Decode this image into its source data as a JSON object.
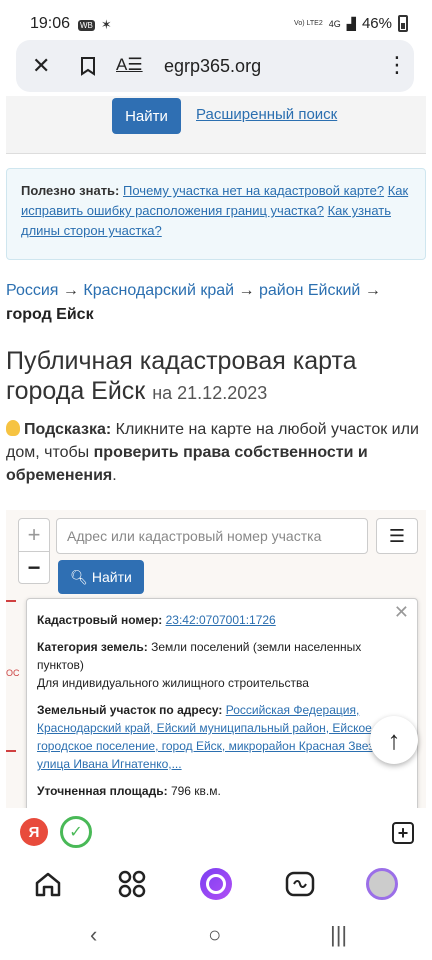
{
  "status": {
    "time": "19:06",
    "badge": "WB",
    "volte": "Vo) LTE2",
    "net": "4G",
    "battery": "46%"
  },
  "browser": {
    "url": "egrp365.org",
    "close_icon": "close-icon",
    "bookmark_icon": "bookmark-icon",
    "reader_icon": "reader-icon",
    "menu_icon": "more-vert-icon"
  },
  "search": {
    "find_label": "Найти",
    "advanced_label": "Расширенный поиск"
  },
  "tip": {
    "prefix": "Полезно знать:",
    "link1": "Почему участка нет на кадастровой карте?",
    "link2": "Как исправить ошибку расположения границ участка?",
    "link3": "Как узнать длины сторон участка?"
  },
  "breadcrumb": {
    "item1": "Россия",
    "item2": "Краснодарский край",
    "item3": "район Ейский",
    "arrow": "→",
    "current": "город Ейск"
  },
  "heading": {
    "title": "Публичная кадастровая карта города Ейск",
    "date": "на 21.12.2023"
  },
  "hint": {
    "label": "Подсказка:",
    "text1": "Кликните на карте на любой участок или дом, чтобы",
    "bold": "проверить права собственности и обременения",
    "end": "."
  },
  "map": {
    "zoom_in": "+",
    "zoom_out": "−",
    "input_placeholder": "Адрес или кадастровый номер участка",
    "find_label": "Найти",
    "side_text": "ОС"
  },
  "popup": {
    "cad_label": "Кадастровый номер:",
    "cad_value": "23:42:0707001:1726",
    "cat_label": "Категория земель:",
    "cat_value": "Земли поселений (земли населенных пунктов)",
    "use_value": "Для индивидуального жилищного строительства",
    "addr_label": "Земельный участок по адресу:",
    "addr_value": "Российская Федерация, Краснодарский край, Ейский муниципальный район, Ейское городское поселение, город Ейск, микрорайон Красная Звезда, улица Ивана Игнатенко,...",
    "area_label": "Уточненная площадь:",
    "area_value": "796 кв.м."
  },
  "toolbar": {
    "ya": "Я",
    "check": "✓",
    "newtab": "+"
  }
}
